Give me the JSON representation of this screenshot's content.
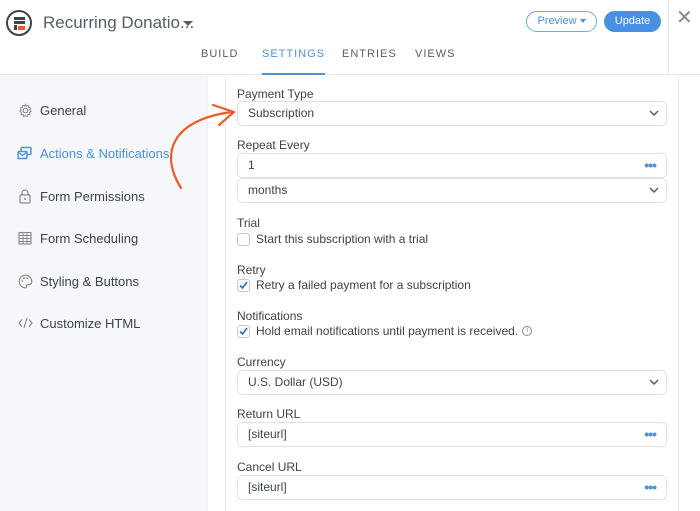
{
  "header": {
    "form_title": "Recurring Donatio...",
    "preview_label": "Preview",
    "update_label": "Update",
    "tabs": [
      {
        "label": "BUILD",
        "active": false
      },
      {
        "label": "SETTINGS",
        "active": true
      },
      {
        "label": "ENTRIES",
        "active": false
      },
      {
        "label": "VIEWS",
        "active": false
      }
    ]
  },
  "sidebar": {
    "items": [
      {
        "label": "General",
        "icon": "gear-icon",
        "active": false
      },
      {
        "label": "Actions & Notifications",
        "icon": "actions-icon",
        "active": true
      },
      {
        "label": "Form Permissions",
        "icon": "lock-icon",
        "active": false
      },
      {
        "label": "Form Scheduling",
        "icon": "calendar-icon",
        "active": false
      },
      {
        "label": "Styling & Buttons",
        "icon": "palette-icon",
        "active": false
      },
      {
        "label": "Customize HTML",
        "icon": "code-icon",
        "active": false
      }
    ]
  },
  "form": {
    "payment_type": {
      "label": "Payment Type",
      "value": "Subscription"
    },
    "repeat_every": {
      "label": "Repeat Every",
      "value": "1",
      "unit": "months"
    },
    "trial": {
      "label": "Trial",
      "checkbox_label": "Start this subscription with a trial",
      "checked": false
    },
    "retry": {
      "label": "Retry",
      "checkbox_label": "Retry a failed payment for a subscription",
      "checked": true
    },
    "notifications": {
      "label": "Notifications",
      "checkbox_label": "Hold email notifications until payment is received.",
      "checked": true,
      "info_glyph": "i"
    },
    "currency": {
      "label": "Currency",
      "value": "U.S. Dollar (USD)"
    },
    "return_url": {
      "label": "Return URL",
      "value": "[siteurl]"
    },
    "cancel_url": {
      "label": "Cancel URL",
      "value": "[siteurl]"
    }
  },
  "colors": {
    "accent": "#4a90e2",
    "annotation_arrow": "#f05a24"
  }
}
